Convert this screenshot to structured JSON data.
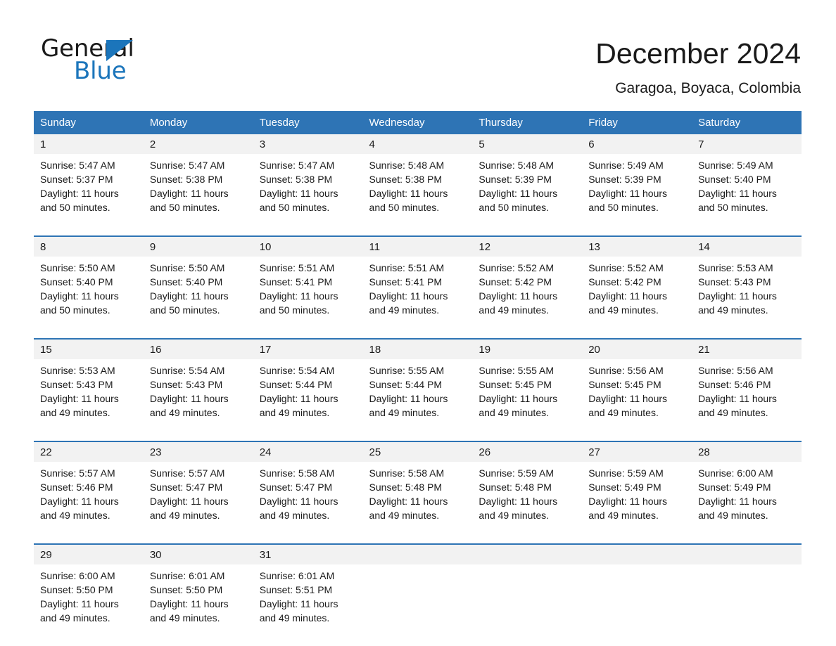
{
  "brand": {
    "name_part1": "General",
    "name_part2": "Blue",
    "logo_icon": "triangle-logo-icon",
    "accent_color": "#1b75bb"
  },
  "header": {
    "title": "December 2024",
    "subtitle": "Garagoa, Boyaca, Colombia"
  },
  "calendar": {
    "header_bg_color": "#2e74b5",
    "daynum_bg_color": "#f2f2f2",
    "weekdays": [
      "Sunday",
      "Monday",
      "Tuesday",
      "Wednesday",
      "Thursday",
      "Friday",
      "Saturday"
    ],
    "weeks": [
      [
        {
          "day": "1",
          "sunrise": "Sunrise: 5:47 AM",
          "sunset": "Sunset: 5:37 PM",
          "daylight": "Daylight: 11 hours and 50 minutes."
        },
        {
          "day": "2",
          "sunrise": "Sunrise: 5:47 AM",
          "sunset": "Sunset: 5:38 PM",
          "daylight": "Daylight: 11 hours and 50 minutes."
        },
        {
          "day": "3",
          "sunrise": "Sunrise: 5:47 AM",
          "sunset": "Sunset: 5:38 PM",
          "daylight": "Daylight: 11 hours and 50 minutes."
        },
        {
          "day": "4",
          "sunrise": "Sunrise: 5:48 AM",
          "sunset": "Sunset: 5:38 PM",
          "daylight": "Daylight: 11 hours and 50 minutes."
        },
        {
          "day": "5",
          "sunrise": "Sunrise: 5:48 AM",
          "sunset": "Sunset: 5:39 PM",
          "daylight": "Daylight: 11 hours and 50 minutes."
        },
        {
          "day": "6",
          "sunrise": "Sunrise: 5:49 AM",
          "sunset": "Sunset: 5:39 PM",
          "daylight": "Daylight: 11 hours and 50 minutes."
        },
        {
          "day": "7",
          "sunrise": "Sunrise: 5:49 AM",
          "sunset": "Sunset: 5:40 PM",
          "daylight": "Daylight: 11 hours and 50 minutes."
        }
      ],
      [
        {
          "day": "8",
          "sunrise": "Sunrise: 5:50 AM",
          "sunset": "Sunset: 5:40 PM",
          "daylight": "Daylight: 11 hours and 50 minutes."
        },
        {
          "day": "9",
          "sunrise": "Sunrise: 5:50 AM",
          "sunset": "Sunset: 5:40 PM",
          "daylight": "Daylight: 11 hours and 50 minutes."
        },
        {
          "day": "10",
          "sunrise": "Sunrise: 5:51 AM",
          "sunset": "Sunset: 5:41 PM",
          "daylight": "Daylight: 11 hours and 50 minutes."
        },
        {
          "day": "11",
          "sunrise": "Sunrise: 5:51 AM",
          "sunset": "Sunset: 5:41 PM",
          "daylight": "Daylight: 11 hours and 49 minutes."
        },
        {
          "day": "12",
          "sunrise": "Sunrise: 5:52 AM",
          "sunset": "Sunset: 5:42 PM",
          "daylight": "Daylight: 11 hours and 49 minutes."
        },
        {
          "day": "13",
          "sunrise": "Sunrise: 5:52 AM",
          "sunset": "Sunset: 5:42 PM",
          "daylight": "Daylight: 11 hours and 49 minutes."
        },
        {
          "day": "14",
          "sunrise": "Sunrise: 5:53 AM",
          "sunset": "Sunset: 5:43 PM",
          "daylight": "Daylight: 11 hours and 49 minutes."
        }
      ],
      [
        {
          "day": "15",
          "sunrise": "Sunrise: 5:53 AM",
          "sunset": "Sunset: 5:43 PM",
          "daylight": "Daylight: 11 hours and 49 minutes."
        },
        {
          "day": "16",
          "sunrise": "Sunrise: 5:54 AM",
          "sunset": "Sunset: 5:43 PM",
          "daylight": "Daylight: 11 hours and 49 minutes."
        },
        {
          "day": "17",
          "sunrise": "Sunrise: 5:54 AM",
          "sunset": "Sunset: 5:44 PM",
          "daylight": "Daylight: 11 hours and 49 minutes."
        },
        {
          "day": "18",
          "sunrise": "Sunrise: 5:55 AM",
          "sunset": "Sunset: 5:44 PM",
          "daylight": "Daylight: 11 hours and 49 minutes."
        },
        {
          "day": "19",
          "sunrise": "Sunrise: 5:55 AM",
          "sunset": "Sunset: 5:45 PM",
          "daylight": "Daylight: 11 hours and 49 minutes."
        },
        {
          "day": "20",
          "sunrise": "Sunrise: 5:56 AM",
          "sunset": "Sunset: 5:45 PM",
          "daylight": "Daylight: 11 hours and 49 minutes."
        },
        {
          "day": "21",
          "sunrise": "Sunrise: 5:56 AM",
          "sunset": "Sunset: 5:46 PM",
          "daylight": "Daylight: 11 hours and 49 minutes."
        }
      ],
      [
        {
          "day": "22",
          "sunrise": "Sunrise: 5:57 AM",
          "sunset": "Sunset: 5:46 PM",
          "daylight": "Daylight: 11 hours and 49 minutes."
        },
        {
          "day": "23",
          "sunrise": "Sunrise: 5:57 AM",
          "sunset": "Sunset: 5:47 PM",
          "daylight": "Daylight: 11 hours and 49 minutes."
        },
        {
          "day": "24",
          "sunrise": "Sunrise: 5:58 AM",
          "sunset": "Sunset: 5:47 PM",
          "daylight": "Daylight: 11 hours and 49 minutes."
        },
        {
          "day": "25",
          "sunrise": "Sunrise: 5:58 AM",
          "sunset": "Sunset: 5:48 PM",
          "daylight": "Daylight: 11 hours and 49 minutes."
        },
        {
          "day": "26",
          "sunrise": "Sunrise: 5:59 AM",
          "sunset": "Sunset: 5:48 PM",
          "daylight": "Daylight: 11 hours and 49 minutes."
        },
        {
          "day": "27",
          "sunrise": "Sunrise: 5:59 AM",
          "sunset": "Sunset: 5:49 PM",
          "daylight": "Daylight: 11 hours and 49 minutes."
        },
        {
          "day": "28",
          "sunrise": "Sunrise: 6:00 AM",
          "sunset": "Sunset: 5:49 PM",
          "daylight": "Daylight: 11 hours and 49 minutes."
        }
      ],
      [
        {
          "day": "29",
          "sunrise": "Sunrise: 6:00 AM",
          "sunset": "Sunset: 5:50 PM",
          "daylight": "Daylight: 11 hours and 49 minutes."
        },
        {
          "day": "30",
          "sunrise": "Sunrise: 6:01 AM",
          "sunset": "Sunset: 5:50 PM",
          "daylight": "Daylight: 11 hours and 49 minutes."
        },
        {
          "day": "31",
          "sunrise": "Sunrise: 6:01 AM",
          "sunset": "Sunset: 5:51 PM",
          "daylight": "Daylight: 11 hours and 49 minutes."
        },
        {
          "day": "",
          "sunrise": "",
          "sunset": "",
          "daylight": ""
        },
        {
          "day": "",
          "sunrise": "",
          "sunset": "",
          "daylight": ""
        },
        {
          "day": "",
          "sunrise": "",
          "sunset": "",
          "daylight": ""
        },
        {
          "day": "",
          "sunrise": "",
          "sunset": "",
          "daylight": ""
        }
      ]
    ]
  }
}
